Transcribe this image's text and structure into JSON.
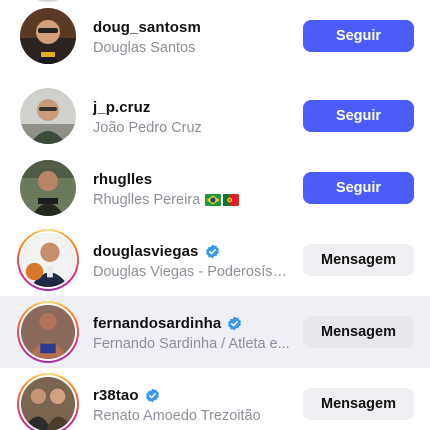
{
  "accounts": [
    {
      "username": "doug_santosm",
      "full_name": "Douglas Santos",
      "verified": false,
      "has_story": false,
      "action": "Seguir",
      "action_type": "follow",
      "avatar_icon": "profile-photo"
    },
    {
      "username": "j_p.cruz",
      "full_name": "João Pedro Cruz",
      "verified": false,
      "has_story": false,
      "action": "Seguir",
      "action_type": "follow",
      "avatar_icon": "profile-photo"
    },
    {
      "username": "rhuglles",
      "full_name": "Rhuglles Pereira",
      "flags": [
        "brazil-flag-icon",
        "portugal-flag-icon"
      ],
      "verified": false,
      "has_story": false,
      "action": "Seguir",
      "action_type": "follow",
      "avatar_icon": "profile-photo"
    },
    {
      "username": "douglasviegas",
      "full_name": "Douglas Viegas - Poderosíssi...",
      "verified": true,
      "has_story": true,
      "action": "Mensagem",
      "action_type": "message",
      "avatar_icon": "profile-photo"
    },
    {
      "username": "fernandosardinha",
      "full_name": "Fernando Sardinha / Atleta e...",
      "verified": true,
      "has_story": true,
      "highlighted": true,
      "action": "Mensagem",
      "action_type": "message",
      "avatar_icon": "profile-photo"
    },
    {
      "username": "r38tao",
      "full_name": "Renato Amoedo Trezoitão",
      "verified": true,
      "has_story": true,
      "action": "Mensagem",
      "action_type": "message",
      "avatar_icon": "profile-photo"
    }
  ],
  "colors": {
    "follow_button": "#4a5df9",
    "message_button": "#eff0f3",
    "verified_badge": "#3897f0",
    "secondary_text": "#8e8e98",
    "highlight_row": "#eef0f5"
  }
}
